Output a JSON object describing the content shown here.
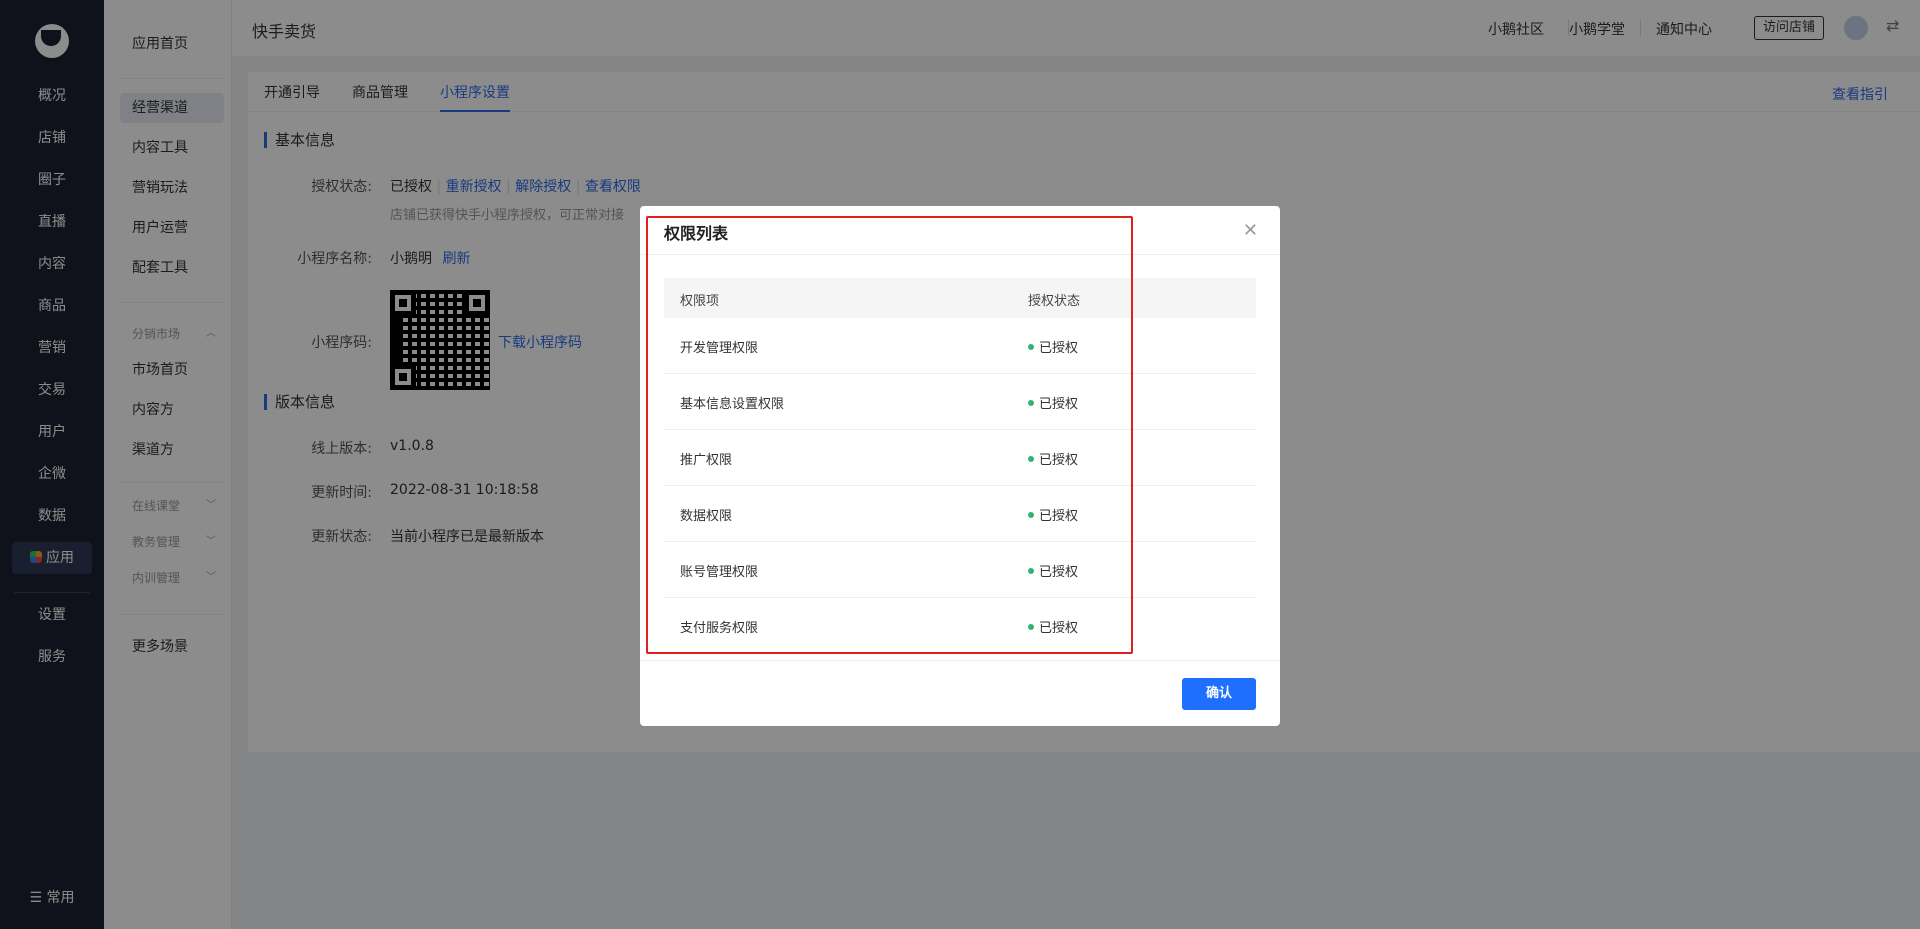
{
  "nav": {
    "items": [
      "概况",
      "店铺",
      "圈子",
      "直播",
      "内容",
      "商品",
      "营销",
      "交易",
      "用户",
      "企微",
      "数据"
    ],
    "active": "应用",
    "bottom_items": [
      "设置",
      "服务"
    ],
    "footer": "常用"
  },
  "side": {
    "top": "应用首页",
    "items": [
      "经营渠道",
      "内容工具",
      "营销玩法",
      "用户运营",
      "配套工具"
    ],
    "group_market": "分销市场",
    "market_items": [
      "市场首页",
      "内容方",
      "渠道方"
    ],
    "groups": [
      "在线课堂",
      "教务管理",
      "内训管理"
    ],
    "more": "更多场景"
  },
  "topbar": {
    "title": "快手卖货",
    "links": [
      "小鹅社区",
      "小鹅学堂",
      "通知中心"
    ],
    "visit": "访问店铺"
  },
  "main": {
    "tabs": [
      "开通引导",
      "商品管理",
      "小程序设置"
    ],
    "guide": "查看指引",
    "basic_title": "基本信息",
    "auth_label": "授权状态:",
    "auth_value": "已授权",
    "auth_actions": [
      "重新授权",
      "解除授权",
      "查看权限"
    ],
    "auth_hint": "店铺已获得快手小程序授权，可正常对接",
    "name_label": "小程序名称:",
    "name_value": "小鹅明",
    "refresh": "刷新",
    "code_label": "小程序码:",
    "download": "下载小程序码",
    "version_title": "版本信息",
    "online_label": "线上版本:",
    "online_value": "v1.0.8",
    "update_time_label": "更新时间:",
    "update_time_value": "2022-08-31 10:18:58",
    "update_status_label": "更新状态:",
    "update_status_value": "当前小程序已是最新版本"
  },
  "modal": {
    "title": "权限列表",
    "col_item": "权限项",
    "col_status": "授权状态",
    "rows": [
      {
        "name": "开发管理权限",
        "status": "已授权"
      },
      {
        "name": "基本信息设置权限",
        "status": "已授权"
      },
      {
        "name": "推广权限",
        "status": "已授权"
      },
      {
        "name": "数据权限",
        "status": "已授权"
      },
      {
        "name": "账号管理权限",
        "status": "已授权"
      },
      {
        "name": "支付服务权限",
        "status": "已授权"
      }
    ],
    "confirm": "确认"
  }
}
